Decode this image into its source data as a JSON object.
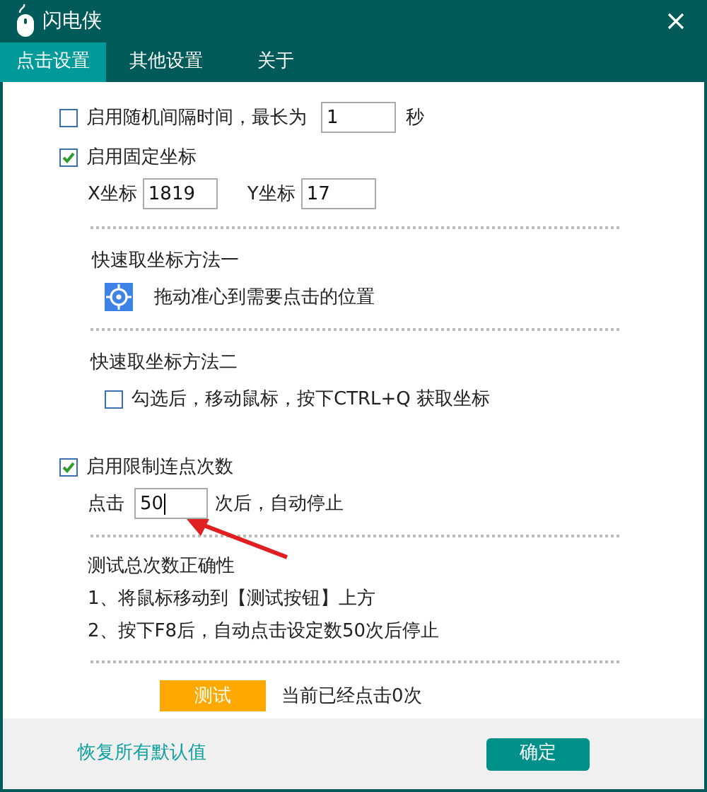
{
  "window": {
    "title": "闪电侠"
  },
  "tabs": [
    {
      "label": "点击设置",
      "selected": true
    },
    {
      "label": "其他设置",
      "selected": false
    },
    {
      "label": "关于",
      "selected": false
    }
  ],
  "random_interval": {
    "label": "启用随机间隔时间，最长为",
    "checked": false,
    "value": "1",
    "unit": "秒"
  },
  "fixed_coords": {
    "label": "启用固定坐标",
    "checked": true,
    "x_label": "X坐标",
    "x_value": "1819",
    "y_label": "Y坐标",
    "y_value": "17"
  },
  "method_one": {
    "title": "快速取坐标方法一",
    "hint": "拖动准心到需要点击的位置"
  },
  "method_two": {
    "title": "快速取坐标方法二",
    "label": "勾选后，移动鼠标，按下CTRL+Q 获取坐标",
    "checked": false
  },
  "limit_clicks": {
    "label": "启用限制连点次数",
    "checked": true,
    "prefix": "点击",
    "value": "50",
    "suffix": "次后，自动停止"
  },
  "test": {
    "title": "测试总次数正确性",
    "steps": [
      "1、将鼠标移动到【测试按钮】上方",
      "2、按下F8后，自动点击设定数50次后停止"
    ],
    "button": "测试",
    "status": "当前已经点击0次"
  },
  "footer": {
    "reset_link": "恢复所有默认值",
    "ok_button": "确定"
  }
}
